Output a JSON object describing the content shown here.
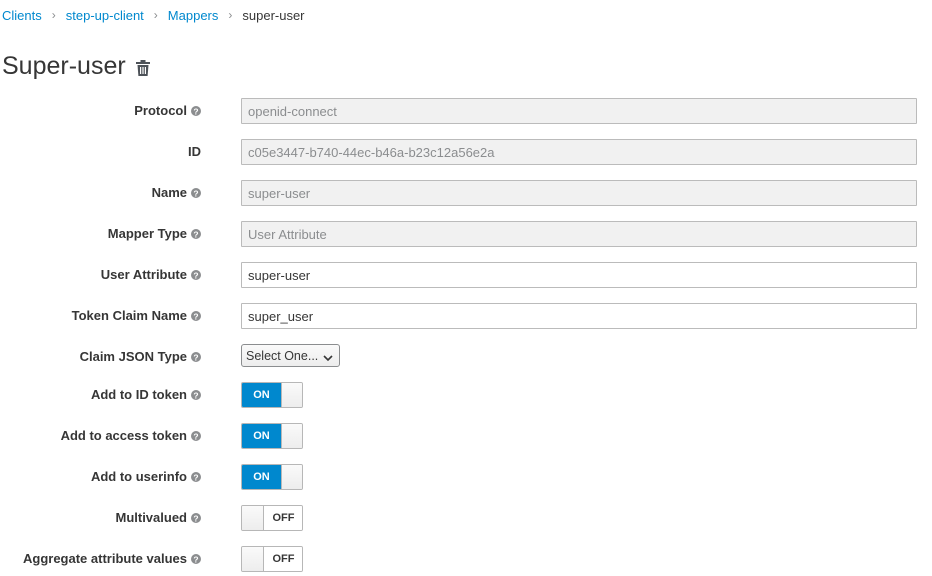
{
  "breadcrumb": {
    "clients": "Clients",
    "client": "step-up-client",
    "mappers": "Mappers",
    "current": "super-user",
    "separator": "›"
  },
  "title": "Super-user",
  "form": {
    "protocol": {
      "label": "Protocol",
      "value": "openid-connect"
    },
    "id": {
      "label": "ID",
      "value": "c05e3447-b740-44ec-b46a-b23c12a56e2a"
    },
    "name": {
      "label": "Name",
      "value": "super-user"
    },
    "mapper_type": {
      "label": "Mapper Type",
      "value": "User Attribute"
    },
    "user_attribute": {
      "label": "User Attribute",
      "value": "super-user"
    },
    "token_claim_name": {
      "label": "Token Claim Name",
      "value": "super_user"
    },
    "claim_json_type": {
      "label": "Claim JSON Type",
      "value": "Select One..."
    },
    "add_to_id_token": {
      "label": "Add to ID token",
      "state": "ON"
    },
    "add_to_access_token": {
      "label": "Add to access token",
      "state": "ON"
    },
    "add_to_userinfo": {
      "label": "Add to userinfo",
      "state": "ON"
    },
    "multivalued": {
      "label": "Multivalued",
      "state": "OFF"
    },
    "aggregate_attribute_values": {
      "label": "Aggregate attribute values",
      "state": "OFF"
    }
  },
  "colors": {
    "accent": "#0088ce",
    "text": "#363636",
    "help_icon": "#8b8d8f"
  },
  "icons": {
    "trash": "trash-icon",
    "help": "help-icon",
    "chevron": "chevron-down-icon"
  }
}
